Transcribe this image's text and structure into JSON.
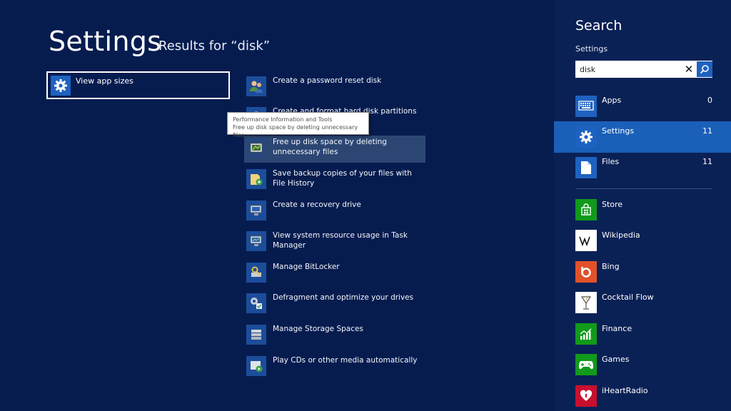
{
  "main": {
    "title": "Settings",
    "results_for": "Results for “disk”",
    "top_result": {
      "label": "View app sizes",
      "icon": "gear-icon"
    },
    "results": [
      {
        "label": "Create a password reset disk",
        "icon": "users-icon"
      },
      {
        "label": "Create and format hard disk partitions",
        "icon": "disk-management-icon"
      },
      {
        "label": "Free up disk space by deleting unnecessary files",
        "icon": "disk-cleanup-icon"
      },
      {
        "label": "Save backup copies of your files with File History",
        "icon": "file-history-icon"
      },
      {
        "label": "Create a recovery drive",
        "icon": "recovery-drive-icon"
      },
      {
        "label": "View system resource usage in Task Manager",
        "icon": "task-manager-icon"
      },
      {
        "label": "Manage BitLocker",
        "icon": "bitlocker-key-icon"
      },
      {
        "label": "Defragment and optimize your drives",
        "icon": "defragment-icon"
      },
      {
        "label": "Manage Storage Spaces",
        "icon": "storage-spaces-icon"
      },
      {
        "label": "Play CDs or other media automatically",
        "icon": "autoplay-icon"
      }
    ],
    "tooltip": {
      "line1": "Performance Information and Tools",
      "line2": "Free up disk space by deleting unnecessary files"
    }
  },
  "charm": {
    "title": "Search",
    "scope_label": "Settings",
    "search": {
      "value": "disk",
      "clear_icon": "close-icon",
      "go_icon": "search-icon"
    },
    "scopes": [
      {
        "label": "Apps",
        "count": "0",
        "icon": "keyboard-icon"
      },
      {
        "label": "Settings",
        "count": "11",
        "icon": "gear-icon"
      },
      {
        "label": "Files",
        "count": "11",
        "icon": "file-icon"
      }
    ],
    "apps": [
      {
        "label": "Store",
        "icon": "store-icon",
        "color": "#119a1b"
      },
      {
        "label": "Wikipedia",
        "icon": "wikipedia-icon",
        "color": "#ffffff"
      },
      {
        "label": "Bing",
        "icon": "bing-icon",
        "color": "#e1522a"
      },
      {
        "label": "Cocktail Flow",
        "icon": "cocktail-icon",
        "color": "#ffffff"
      },
      {
        "label": "Finance",
        "icon": "finance-icon",
        "color": "#119a1b"
      },
      {
        "label": "Games",
        "icon": "games-icon",
        "color": "#119a1b"
      },
      {
        "label": "iHeartRadio",
        "icon": "iheartradio-icon",
        "color": "#c8102e"
      }
    ]
  }
}
